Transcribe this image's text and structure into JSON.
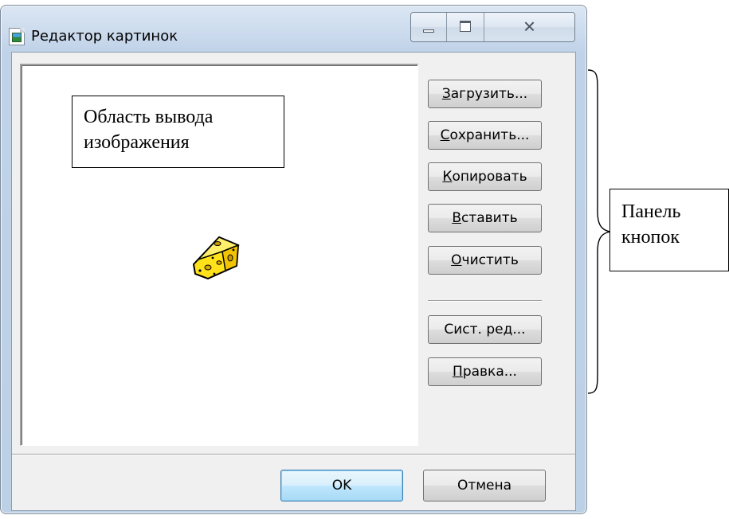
{
  "window": {
    "title": "Редактор картинок",
    "caption_buttons": [
      "minimize",
      "maximize",
      "close"
    ]
  },
  "side_buttons": [
    {
      "pre": "",
      "ul": "З",
      "post": "агрузить..."
    },
    {
      "pre": "",
      "ul": "С",
      "post": "охранить..."
    },
    {
      "pre": "",
      "ul": "К",
      "post": "опировать"
    },
    {
      "pre": "",
      "ul": "В",
      "post": "ставить"
    },
    {
      "pre": "",
      "ul": "О",
      "post": "чистить"
    },
    {
      "pre": "Сист. ред...",
      "ul": "",
      "post": ""
    },
    {
      "pre": "",
      "ul": "П",
      "post": "равка..."
    }
  ],
  "footer": {
    "ok_label": "OK",
    "cancel_label": "Отмена"
  },
  "annotations": {
    "image_area": {
      "line1": "Область вывода",
      "line2": "изображения"
    },
    "button_panel": {
      "line1": "Панель",
      "line2": "кнопок"
    }
  },
  "colors": {
    "window_frame": "#bfd2e8",
    "client_bg": "#f0f0f0",
    "ok_button_border": "#3c7fb1",
    "cheese_fill": "#ffe21a"
  },
  "icons": {
    "app": "picture-document-icon",
    "image": "cheese-icon"
  }
}
